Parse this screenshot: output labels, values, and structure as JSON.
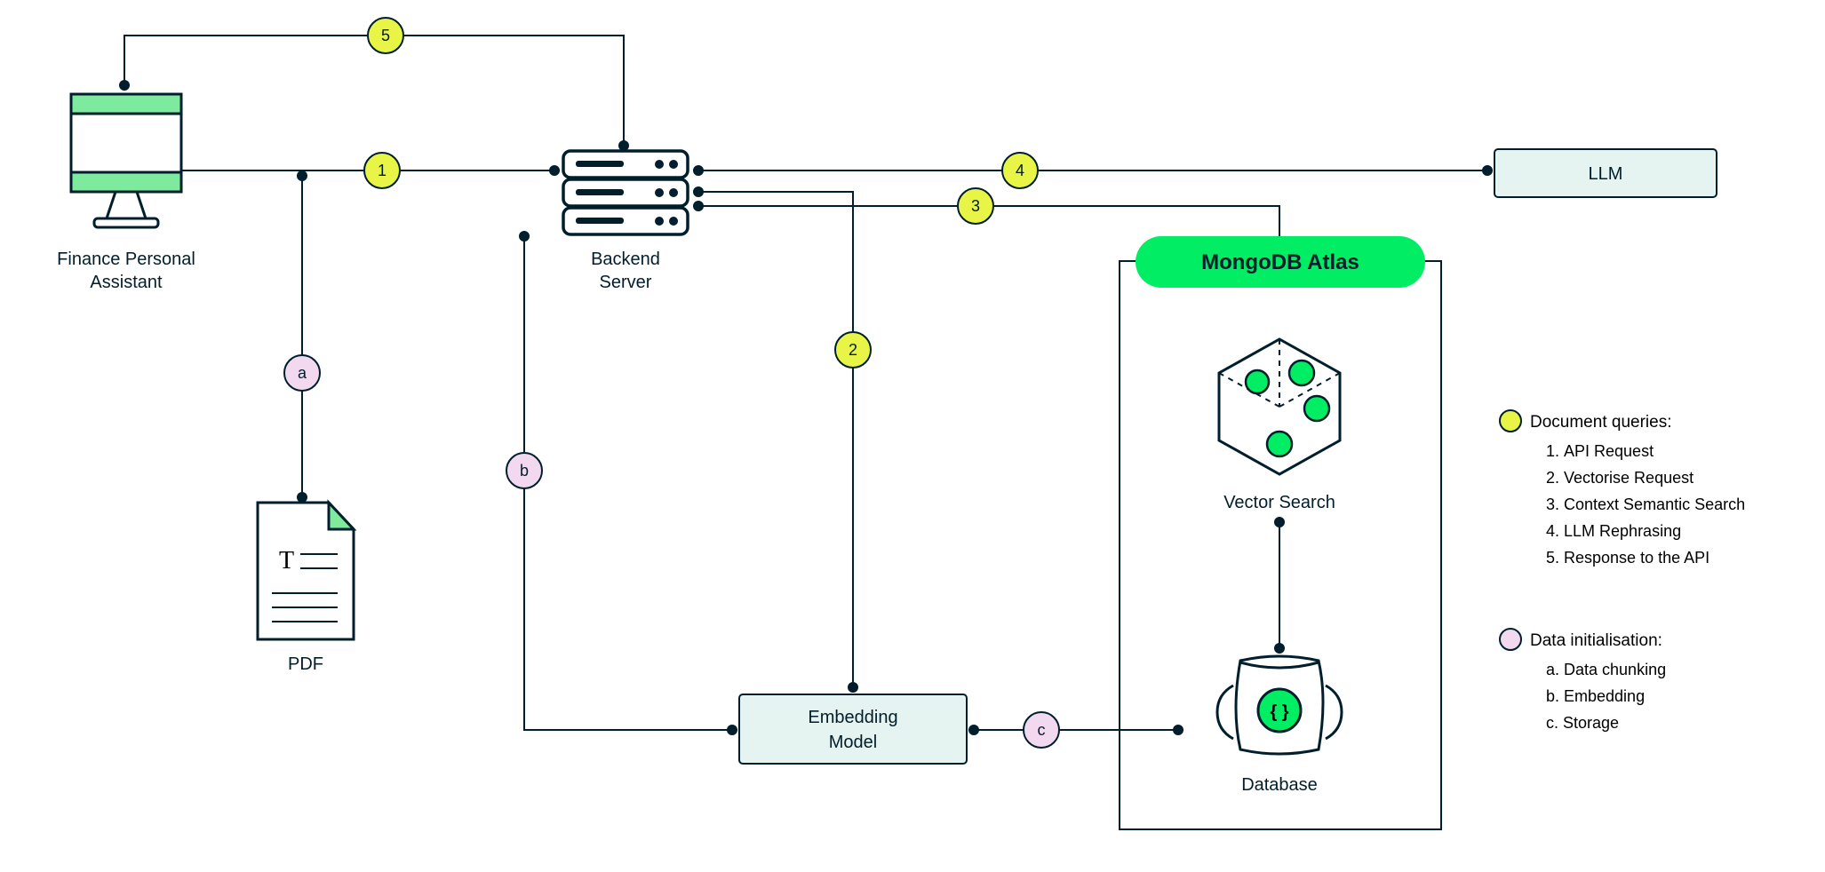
{
  "nodes": {
    "client": "Finance Personal\nAssistant",
    "server": "Backend\nServer",
    "llm": "LLM",
    "pdf": "PDF",
    "embed": "Embedding\nModel",
    "atlas": "MongoDB Atlas",
    "vsearch": "Vector Search",
    "db": "Database"
  },
  "badges": {
    "n1": "1",
    "n2": "2",
    "n3": "3",
    "n4": "4",
    "n5": "5",
    "la": "a",
    "lb": "b",
    "lc": "c"
  },
  "legend": {
    "queries": {
      "title": "Document queries:",
      "items": [
        "API Request",
        "Vectorise Request",
        "Context Semantic Search",
        "LLM Rephrasing",
        "Response to the API"
      ]
    },
    "init": {
      "title": "Data initialisation:",
      "items": [
        "Data chunking",
        "Embedding",
        "Storage"
      ]
    }
  },
  "colors": {
    "green": "#00ed64",
    "greenLight": "#7dea9e",
    "teal": "#e6f4f1",
    "yellow": "#e8f547",
    "pink": "#f3d9f0",
    "ink": "#001e2b"
  }
}
